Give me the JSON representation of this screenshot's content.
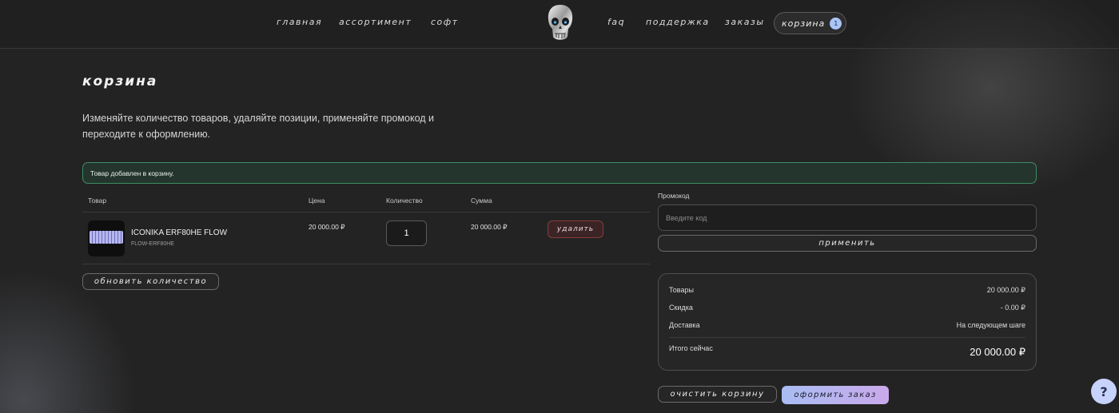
{
  "nav": {
    "home": "главная",
    "assortment": "ассортимент",
    "soft": "софт",
    "faq": "faq",
    "support": "поддержка",
    "orders": "заказы",
    "cart": "корзина",
    "cart_count": "1"
  },
  "page": {
    "title": "корзина",
    "subtitle": "Изменяйте количество товаров, удаляйте позиции, применяйте промокод и переходите к оформлению.",
    "alert": "Товар добавлен в корзину."
  },
  "table": {
    "headers": {
      "product": "Товар",
      "price": "Цена",
      "quantity": "Количество",
      "sum": "Сумма"
    },
    "rows": [
      {
        "name": "ICONIKA ERF80HE FLOW",
        "sku": "FLOW-ERF80HE",
        "price": "20 000.00 ₽",
        "quantity": "1",
        "sum": "20 000.00 ₽",
        "delete_label": "удалить"
      }
    ],
    "update_label": "обновить количество"
  },
  "promo": {
    "label": "Промокод",
    "placeholder": "Введите код",
    "value": "",
    "apply_label": "применить"
  },
  "summary": {
    "items_label": "Товары",
    "items_value": "20 000.00 ₽",
    "discount_label": "Скидка",
    "discount_value": "- 0.00 ₽",
    "delivery_label": "Доставка",
    "delivery_value": "На следующем шаге",
    "total_label": "Итого сейчас",
    "total_value": "20 000.00 ₽"
  },
  "actions": {
    "clear_label": "очистить корзину",
    "checkout_label": "оформить заказ",
    "help_label": "?"
  },
  "colors": {
    "accent_gradient_start": "#a9bdf3",
    "accent_gradient_end": "#c9a9ea",
    "success_border": "#3f8c66",
    "danger_border": "#8c3a3a"
  }
}
